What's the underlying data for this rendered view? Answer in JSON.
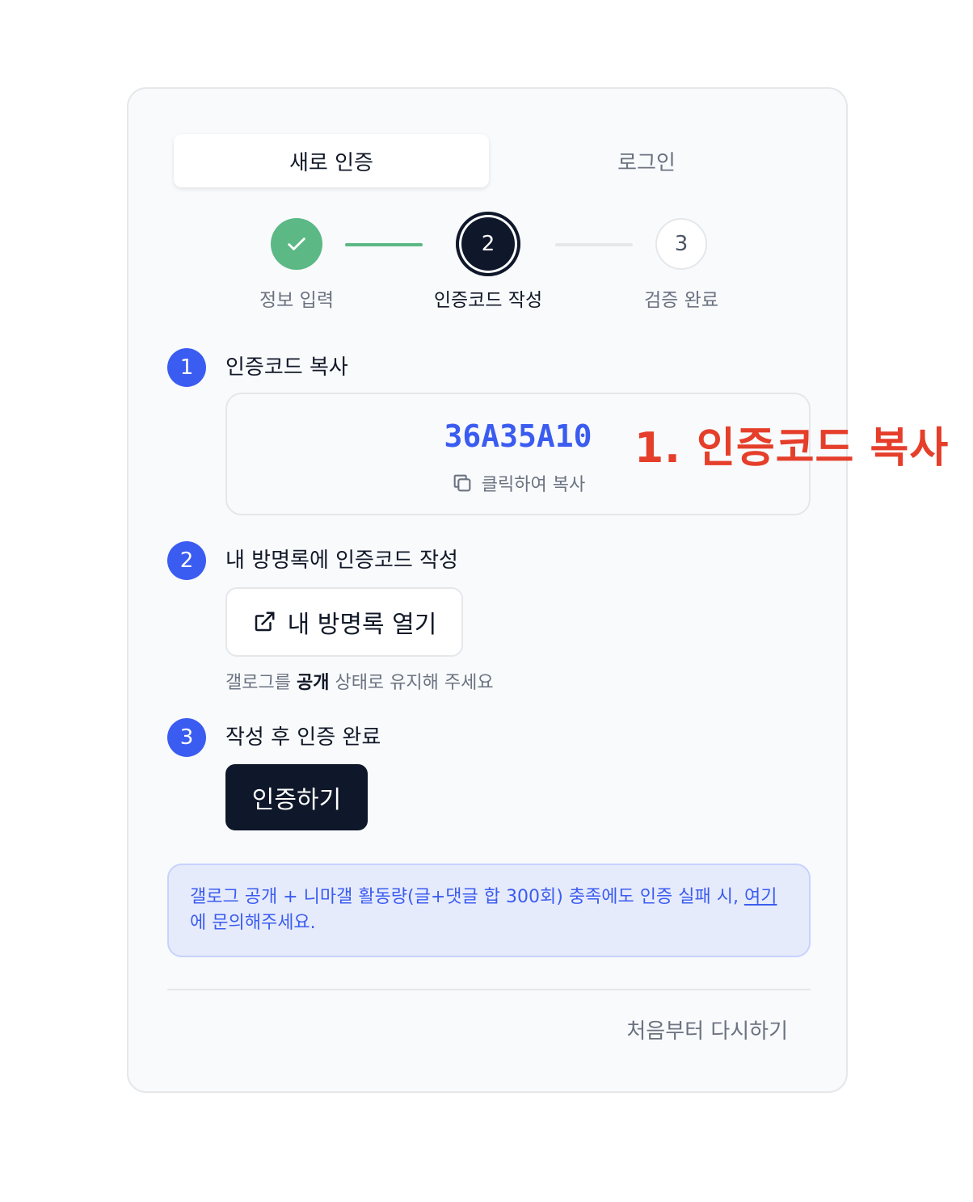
{
  "tabs": {
    "active": "새로 인증",
    "inactive": "로그인"
  },
  "stepper": {
    "steps": [
      {
        "label": "정보 입력",
        "state": "done"
      },
      {
        "label": "인증코드 작성",
        "number": "2",
        "state": "current"
      },
      {
        "label": "검증 완료",
        "number": "3",
        "state": "todo"
      }
    ]
  },
  "section1": {
    "number": "1",
    "title": "인증코드 복사",
    "code": "36A35A10",
    "copy_hint": "클릭하여 복사"
  },
  "annotation": "1. 인증코드 복사",
  "section2": {
    "number": "2",
    "title": "내 방명록에 인증코드 작성",
    "open_button": "내 방명록 열기",
    "hint_prefix": "갤로그를",
    "hint_bold": "공개",
    "hint_suffix": "상태로 유지해 주세요"
  },
  "section3": {
    "number": "3",
    "title": "작성 후 인증 완료",
    "verify_button": "인증하기"
  },
  "info": {
    "text_before": "갤로그 공개 + 니마갤 활동량(글+댓글 합 300회) 충족에도 인증 실패 시,",
    "link": "여기",
    "text_after": "에 문의해주세요."
  },
  "footer": {
    "restart": "처음부터 다시하기"
  },
  "colors": {
    "accent": "#3b5cf0",
    "success": "#5cb885",
    "dark": "#0f172a",
    "annotation": "#e53e2a"
  }
}
